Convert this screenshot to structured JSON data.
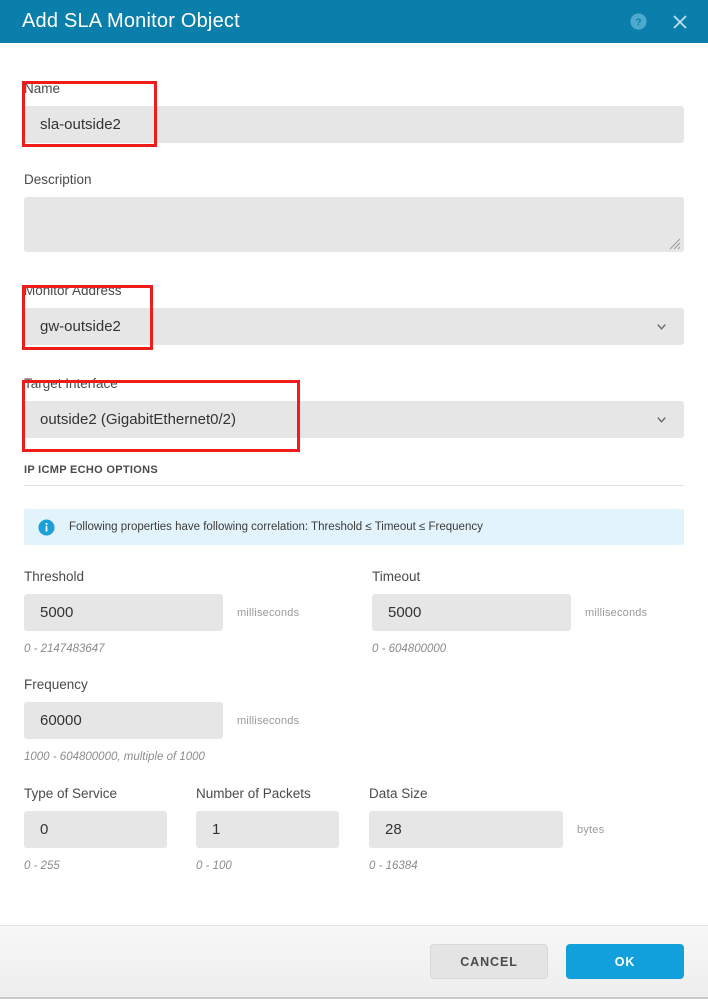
{
  "header": {
    "title": "Add SLA Monitor Object",
    "help_icon": "help-circle-icon",
    "close_icon": "close-icon",
    "background_color": "#0b7fab"
  },
  "form": {
    "name": {
      "label": "Name",
      "value": "sla-outside2",
      "placeholder": ""
    },
    "description": {
      "label": "Description",
      "value": "",
      "placeholder": ""
    },
    "monitor_address": {
      "label": "Monitor Address",
      "value": "gw-outside2",
      "icon": "chevron-down-icon"
    },
    "target_interface": {
      "label": "Target Interface",
      "value": "outside2 (GigabitEthernet0/2)",
      "icon": "chevron-down-icon"
    }
  },
  "section": {
    "title": "IP ICMP ECHO OPTIONS",
    "info_banner": {
      "icon": "info-circle-icon",
      "text": "Following properties have following correlation: Threshold ≤ Timeout ≤ Frequency",
      "background_color": "#e2f3fb"
    }
  },
  "numeric_fields": {
    "threshold": {
      "label": "Threshold",
      "value": "5000",
      "unit": "milliseconds",
      "range": "0 - 2147483647"
    },
    "timeout": {
      "label": "Timeout",
      "value": "5000",
      "unit": "milliseconds",
      "range": "0 - 604800000"
    },
    "frequency": {
      "label": "Frequency",
      "value": "60000",
      "unit": "milliseconds",
      "range": "1000 - 604800000, multiple of 1000"
    },
    "type_of_service": {
      "label": "Type of Service",
      "value": "0",
      "unit": "",
      "range": "0 - 255"
    },
    "number_of_packets": {
      "label": "Number of Packets",
      "value": "1",
      "unit": "",
      "range": "0 - 100"
    },
    "data_size": {
      "label": "Data Size",
      "value": "28",
      "unit": "bytes",
      "range": "0 - 16384"
    }
  },
  "footer": {
    "cancel_label": "CANCEL",
    "ok_label": "OK",
    "ok_color": "#12a0dc"
  },
  "annotations": {
    "color": "#ee1c1c",
    "boxes": [
      {
        "name": "name-field-highlight"
      },
      {
        "name": "monitor-address-highlight"
      },
      {
        "name": "target-interface-highlight"
      }
    ]
  }
}
